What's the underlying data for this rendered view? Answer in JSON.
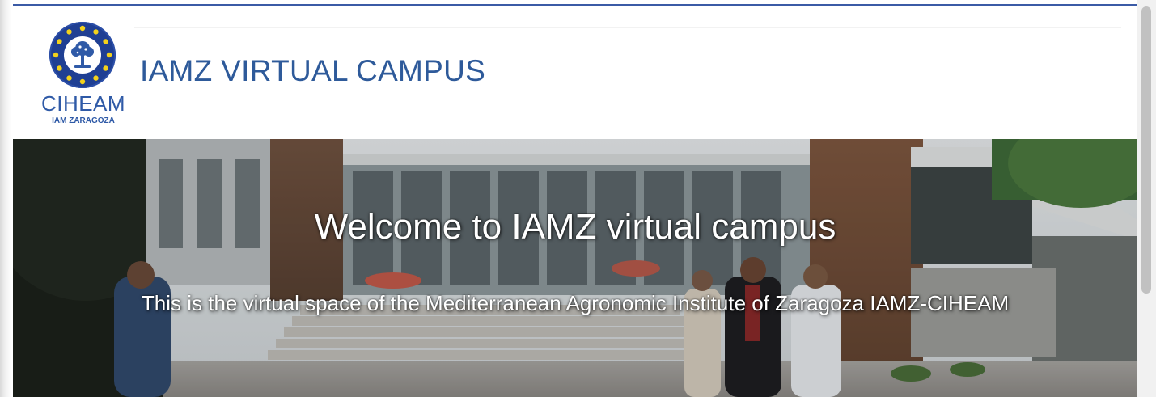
{
  "header": {
    "logo": {
      "word": "CIHEAM",
      "sub": "IAM ZARAGOZA",
      "emblem_icon": "ciheam-emblem-icon"
    },
    "site_title": "IAMZ VIRTUAL CAMPUS"
  },
  "hero": {
    "title": "Welcome to IAMZ virtual campus",
    "subtitle": "This is the virtual space of the Mediterranean Agronomic Institute of Zaragoza IAMZ-CIHEAM",
    "background": "campus-building-photo"
  },
  "colors": {
    "brand_blue": "#2f5aa7",
    "title_blue": "#2e5a9a",
    "top_rule": "#3b5ba6",
    "hero_text": "#ffffff"
  }
}
